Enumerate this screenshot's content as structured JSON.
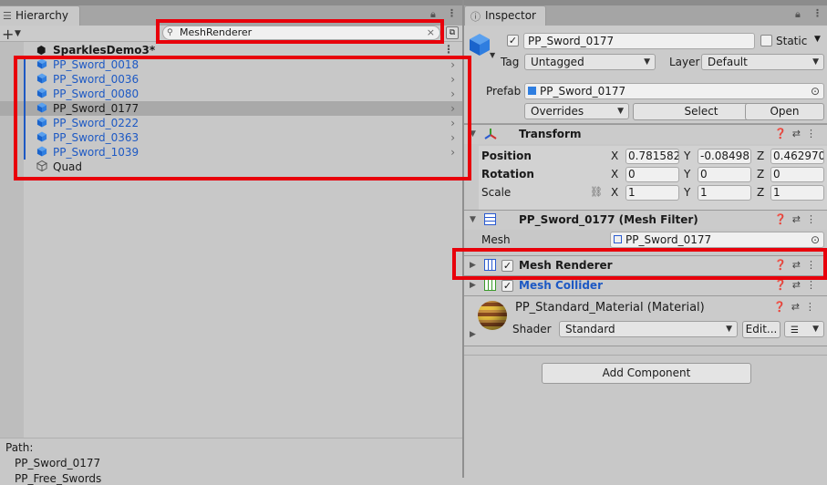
{
  "hierarchy": {
    "tab_label": "Hierarchy",
    "search_value": "MeshRenderer",
    "scene_name": "SparklesDemo3*",
    "items": [
      {
        "label": "PP_Sword_0018",
        "prefab": true
      },
      {
        "label": "PP_Sword_0036",
        "prefab": true
      },
      {
        "label": "PP_Sword_0080",
        "prefab": true
      },
      {
        "label": "PP_Sword_0177",
        "prefab": true,
        "selected": true
      },
      {
        "label": "PP_Sword_0222",
        "prefab": true
      },
      {
        "label": "PP_Sword_0363",
        "prefab": true
      },
      {
        "label": "PP_Sword_1039",
        "prefab": true
      },
      {
        "label": "Quad",
        "prefab": false
      }
    ],
    "path_label": "Path:",
    "path_lines": [
      "PP_Sword_0177",
      "PP_Free_Swords"
    ]
  },
  "inspector": {
    "tab_label": "Inspector",
    "object_name": "PP_Sword_0177",
    "static_label": "Static",
    "tag_label": "Tag",
    "tag_value": "Untagged",
    "layer_label": "Layer",
    "layer_value": "Default",
    "prefab_label": "Prefab",
    "prefab_value": "PP_Sword_0177",
    "overrides_label": "Overrides",
    "select_label": "Select",
    "open_label": "Open",
    "transform": {
      "title": "Transform",
      "position_label": "Position",
      "rotation_label": "Rotation",
      "scale_label": "Scale",
      "position": {
        "x": "0.781582",
        "y": "-0.08498",
        "z": "0.462970"
      },
      "rotation": {
        "x": "0",
        "y": "0",
        "z": "0"
      },
      "scale": {
        "x": "1",
        "y": "1",
        "z": "1"
      },
      "axis_x": "X",
      "axis_y": "Y",
      "axis_z": "Z"
    },
    "mesh_filter": {
      "title": "PP_Sword_0177 (Mesh Filter)",
      "mesh_label": "Mesh",
      "mesh_value": "PP_Sword_0177"
    },
    "mesh_renderer": {
      "title": "Mesh Renderer"
    },
    "mesh_collider": {
      "title": "Mesh Collider"
    },
    "material": {
      "title": "PP_Standard_Material (Material)",
      "shader_label": "Shader",
      "shader_value": "Standard",
      "edit_label": "Edit..."
    },
    "add_component_label": "Add Component"
  },
  "colors": {
    "highlight": "#e8000b",
    "prefab_blue": "#1d59c4"
  }
}
